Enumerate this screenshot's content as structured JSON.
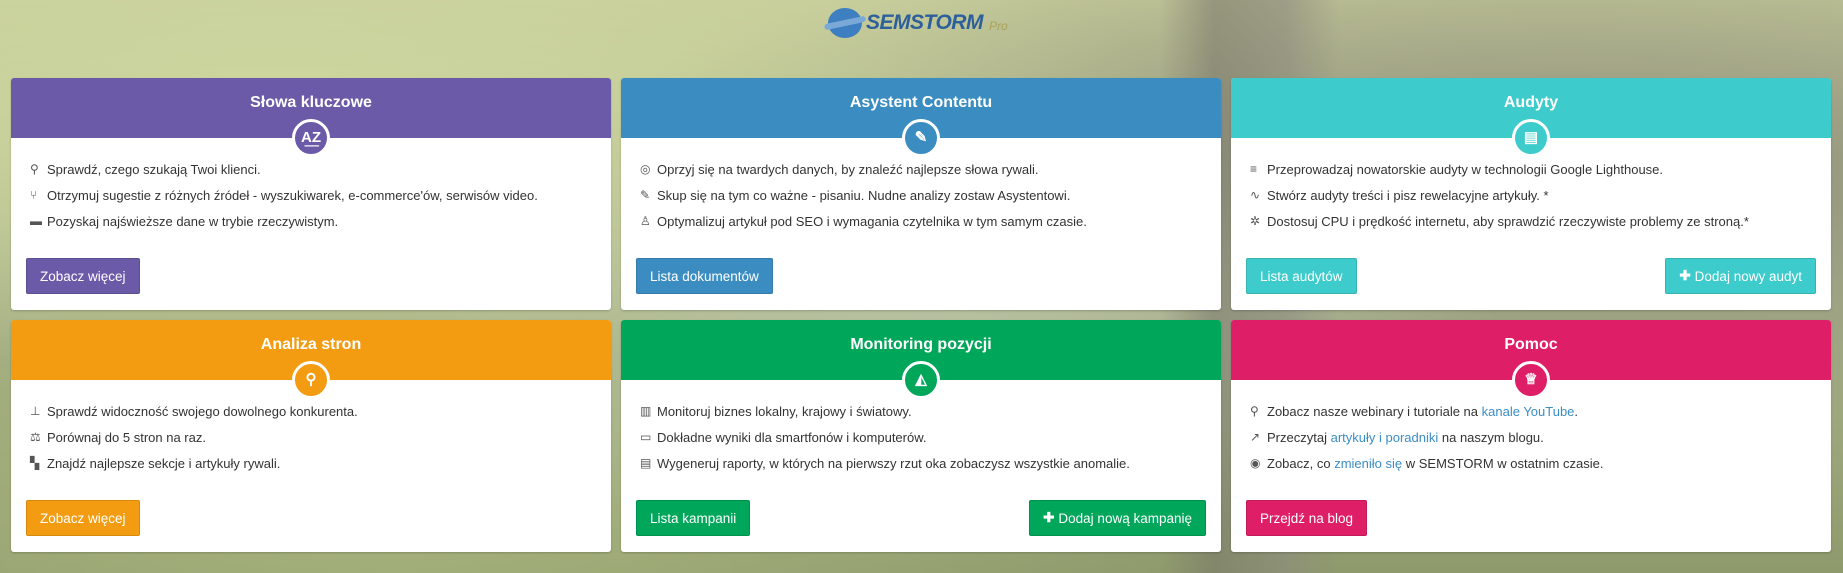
{
  "logo": {
    "text": "SEMSTORM",
    "sub": "Pro"
  },
  "cards": [
    {
      "title": "Słowa kluczowe",
      "badge": "A͟Z",
      "color": "#6a5aa8",
      "features": [
        {
          "icon": "⚲",
          "text": "Sprawdź, czego szukają Twoi klienci."
        },
        {
          "icon": "⑂",
          "text": "Otrzymuj sugestie z różnych źródeł - wyszukiwarek, e-commerce'ów, serwisów video."
        },
        {
          "icon": "▬",
          "text": "Pozyskaj najświeższe dane w trybie rzeczywistym."
        }
      ],
      "buttons": {
        "left": "Zobacz więcej"
      }
    },
    {
      "title": "Asystent Contentu",
      "badge": "✎",
      "color": "#3b8dc1",
      "features": [
        {
          "icon": "◎",
          "text": "Oprzyj się na twardych danych, by znaleźć najlepsze słowa rywali."
        },
        {
          "icon": "✎",
          "text": "Skup się na tym co ważne - pisaniu. Nudne analizy zostaw Asystentowi."
        },
        {
          "icon": "♙",
          "text": "Optymalizuj artykuł pod SEO i wymagania czytelnika w tym samym czasie."
        }
      ],
      "buttons": {
        "left": "Lista dokumentów"
      }
    },
    {
      "title": "Audyty",
      "badge": "▤",
      "color": "#3ecbcb",
      "features": [
        {
          "icon": "≡",
          "text": "Przeprowadzaj nowatorskie audyty w technologii Google Lighthouse."
        },
        {
          "icon": "∿",
          "text": "Stwórz audyty treści i pisz rewelacyjne artykuły. *"
        },
        {
          "icon": "✲",
          "text": "Dostosuj CPU i prędkość internetu, aby sprawdzić rzeczywiste problemy ze stroną.*"
        }
      ],
      "buttons": {
        "left": "Lista audytów",
        "right": "Dodaj nowy audyt"
      }
    },
    {
      "title": "Analiza stron",
      "badge": "⚲",
      "color": "#f39c12",
      "features": [
        {
          "icon": "⊥",
          "text": "Sprawdź widoczność swojego dowolnego konkurenta."
        },
        {
          "icon": "⚖",
          "text": "Porównaj do 5 stron na raz."
        },
        {
          "icon": "▚",
          "text": "Znajdź najlepsze sekcje i artykuły rywali."
        }
      ],
      "buttons": {
        "left": "Zobacz więcej"
      }
    },
    {
      "title": "Monitoring pozycji",
      "badge": "◭",
      "color": "#00a65a",
      "features": [
        {
          "icon": "▥",
          "text": "Monitoruj biznes lokalny, krajowy i światowy."
        },
        {
          "icon": "▭",
          "text": "Dokładne wyniki dla smartfonów i komputerów."
        },
        {
          "icon": "▤",
          "text": "Wygeneruj raporty, w których na pierwszy rzut oka zobaczysz wszystkie anomalie."
        }
      ],
      "buttons": {
        "left": "Lista kampanii",
        "right": "Dodaj nową kampanię"
      }
    },
    {
      "title": "Pomoc",
      "badge": "♕",
      "color": "#de1e66",
      "features": [
        {
          "icon": "⚲",
          "pre": "Zobacz nasze webinary i tutoriale na ",
          "link": "kanale YouTube",
          "post": "."
        },
        {
          "icon": "↗",
          "pre": "Przeczytaj ",
          "link": "artykuły i poradniki",
          "post": " na naszym blogu."
        },
        {
          "icon": "◉",
          "pre": "Zobacz, co ",
          "link": "zmieniło się",
          "post": " w SEMSTORM w ostatnim czasie."
        }
      ],
      "buttons": {
        "left": "Przejdź na blog"
      }
    }
  ]
}
